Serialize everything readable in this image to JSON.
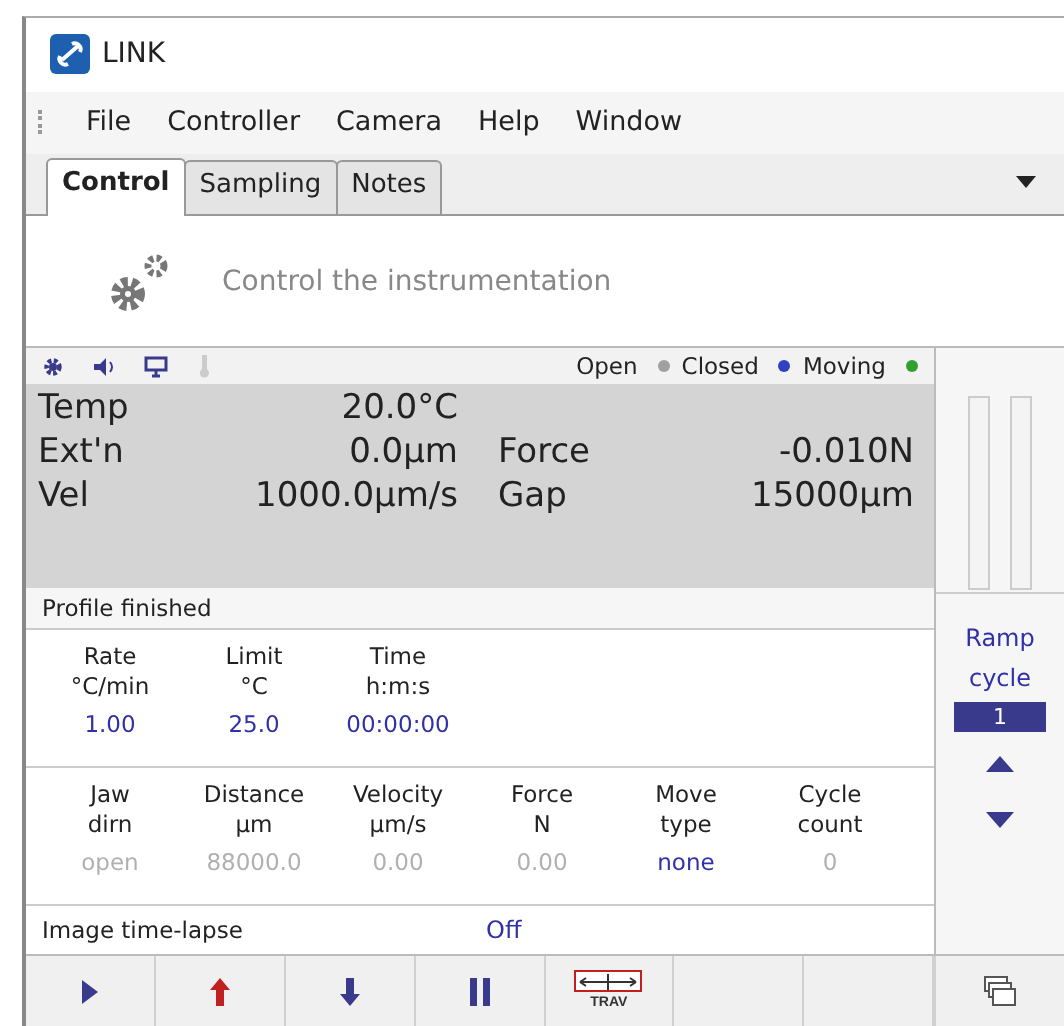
{
  "window": {
    "title": "LINK"
  },
  "menu": [
    "File",
    "Controller",
    "Camera",
    "Help",
    "Window"
  ],
  "tabs": [
    {
      "label": "Control",
      "selected": true
    },
    {
      "label": "Sampling",
      "selected": false
    },
    {
      "label": "Notes",
      "selected": false
    }
  ],
  "header": {
    "text": "Control the instrumentation"
  },
  "status_icons": [
    {
      "kind": "gear",
      "disabled": false
    },
    {
      "kind": "speaker",
      "disabled": false
    },
    {
      "kind": "monitor",
      "disabled": false
    },
    {
      "kind": "thermometer",
      "disabled": true
    }
  ],
  "indicators": [
    {
      "label": "Open",
      "color": "#a0a0a0"
    },
    {
      "label": "Closed",
      "color": "#3040c0"
    },
    {
      "label": "Moving",
      "color": "#30a030"
    }
  ],
  "readings": [
    {
      "label": "Temp",
      "value": "20.0°C"
    },
    {
      "label": "Ext'n",
      "value": "0.0µm",
      "label2": "Force",
      "value2": "-0.010N"
    },
    {
      "label": "Vel",
      "value": "1000.0µm/s",
      "label2": "Gap",
      "value2": "15000µm"
    }
  ],
  "profile_status": "Profile finished",
  "ramp_table": [
    {
      "heading": [
        "Rate",
        "°C/min"
      ],
      "value": "1.00",
      "disabled": false
    },
    {
      "heading": [
        "Limit",
        "°C"
      ],
      "value": "25.0",
      "disabled": false
    },
    {
      "heading": [
        "Time",
        "h:m:s"
      ],
      "value": "00:00:00",
      "disabled": false
    }
  ],
  "move_table": [
    {
      "heading": [
        "Jaw",
        "dirn"
      ],
      "value": "open",
      "disabled": true
    },
    {
      "heading": [
        "Distance",
        "µm"
      ],
      "value": "88000.0",
      "disabled": true
    },
    {
      "heading": [
        "Velocity",
        "µm/s"
      ],
      "value": "0.00",
      "disabled": true
    },
    {
      "heading": [
        "Force",
        "N"
      ],
      "value": "0.00",
      "disabled": true
    },
    {
      "heading": [
        "Move",
        "type"
      ],
      "value": "none",
      "disabled": false
    },
    {
      "heading": [
        "Cycle",
        "count"
      ],
      "value": "0",
      "disabled": true
    }
  ],
  "time_lapse": {
    "label": "Image time-lapse",
    "value": "Off"
  },
  "ramp_cycle": {
    "label": [
      "Ramp",
      "cycle"
    ],
    "value": "1"
  },
  "toolbar": [
    {
      "kind": "play"
    },
    {
      "kind": "up"
    },
    {
      "kind": "down"
    },
    {
      "kind": "pause"
    },
    {
      "kind": "trav",
      "label": "TRAV"
    },
    {
      "kind": "empty"
    },
    {
      "kind": "empty"
    },
    {
      "kind": "windows"
    }
  ]
}
